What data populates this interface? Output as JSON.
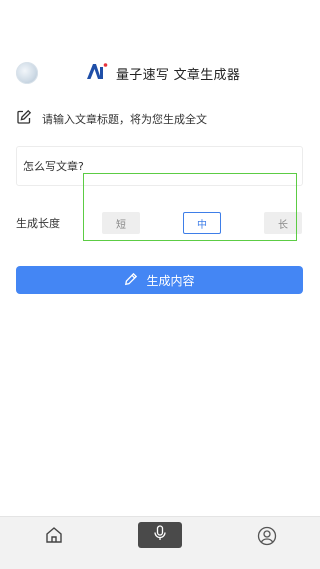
{
  "header": {
    "title": "量子速写 文章生成器"
  },
  "prompt": {
    "text": "请输入文章标题，将为您生成全文"
  },
  "title_input": {
    "value": "怎么写文章?"
  },
  "length": {
    "label": "生成长度",
    "options": [
      "短",
      "中",
      "长"
    ],
    "selected": "中"
  },
  "generate_button": {
    "label": "生成内容"
  },
  "bottom_nav": {
    "items": [
      "home-icon",
      "microphone-icon",
      "profile-icon"
    ],
    "active": "microphone-icon"
  },
  "colors": {
    "accent": "#4486f4",
    "highlight_box": "#5ccc44",
    "nav_active_bg": "#4a4a4a"
  }
}
